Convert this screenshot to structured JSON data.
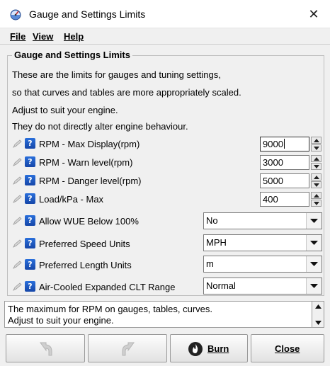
{
  "window": {
    "title": "Gauge and Settings Limits",
    "close_glyph": "✕"
  },
  "menu": {
    "file": "File",
    "view": "View",
    "help": "Help"
  },
  "group": {
    "title": "Gauge and Settings Limits",
    "description": [
      "These are the limits for gauges and tuning settings,",
      "so that curves and tables are more appropriately scaled.",
      "Adjust to suit your engine.",
      "They do not directly alter engine behaviour."
    ]
  },
  "numeric_settings": [
    {
      "label": "RPM - Max Display(rpm)",
      "value": "9000"
    },
    {
      "label": "RPM - Warn level(rpm)",
      "value": "3000"
    },
    {
      "label": "RPM - Danger level(rpm)",
      "value": "5000"
    },
    {
      "label": "Load/kPa - Max",
      "value": "400"
    }
  ],
  "select_settings": [
    {
      "label": "Allow WUE Below 100%",
      "value": "No"
    },
    {
      "label": "Preferred Speed Units",
      "value": "MPH"
    },
    {
      "label": "Preferred Length Units",
      "value": "m"
    },
    {
      "label": "Air-Cooled Expanded CLT Range",
      "value": "Normal"
    }
  ],
  "help_text": [
    "The maximum for RPM on gauges, tables, curves.",
    "Adjust to suit your engine."
  ],
  "buttons": {
    "undo": "",
    "redo": "",
    "burn": "Burn",
    "close": "Close"
  },
  "icons": {
    "app": "gauge-app-icon",
    "edit": "pencil-icon",
    "help": "question-icon",
    "undo": "undo-arrow-icon",
    "redo": "redo-arrow-icon",
    "burn": "flame-icon"
  },
  "colors": {
    "help_icon": "#1e5bc6",
    "window_bg": "#f0f0f0"
  }
}
